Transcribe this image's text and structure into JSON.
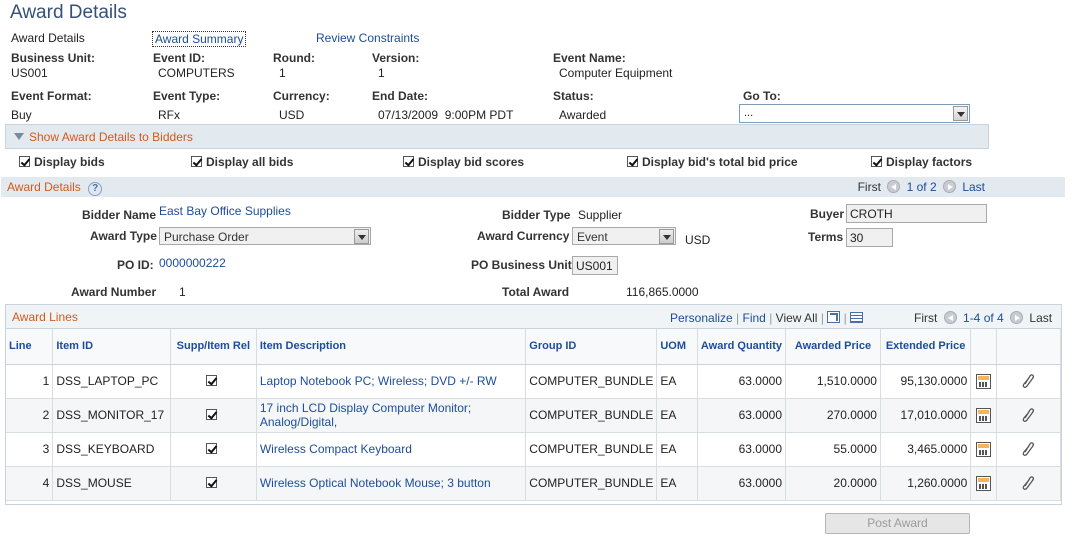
{
  "page": {
    "title": "Award Details"
  },
  "tabs": [
    {
      "label": "Award Details"
    },
    {
      "label": "Award Summary"
    },
    {
      "label": "Review Constraints"
    }
  ],
  "event": {
    "business_unit": {
      "label": "Business Unit:",
      "value": "US001"
    },
    "event_id": {
      "label": "Event ID:",
      "value": "COMPUTERS"
    },
    "round": {
      "label": "Round:",
      "value": "1"
    },
    "version": {
      "label": "Version:",
      "value": "1"
    },
    "event_name": {
      "label": "Event Name:",
      "value": "Computer Equipment"
    },
    "event_format": {
      "label": "Event Format:",
      "value": "Buy"
    },
    "event_type": {
      "label": "Event Type:",
      "value": "RFx"
    },
    "currency": {
      "label": "Currency:",
      "value": "USD"
    },
    "end_date": {
      "label": "End Date:",
      "value": "07/13/2009  9:00PM PDT"
    },
    "status": {
      "label": "Status:",
      "value": "Awarded"
    },
    "goto": {
      "label": "Go To:",
      "value": "..."
    }
  },
  "show_bar": {
    "label": "Show Award Details to Bidders"
  },
  "checkboxes": [
    {
      "label": "Display bids",
      "checked": true
    },
    {
      "label": "Display all bids",
      "checked": true
    },
    {
      "label": "Display bid scores",
      "checked": true
    },
    {
      "label": "Display bid's total bid price",
      "checked": true
    },
    {
      "label": "Display factors",
      "checked": true
    }
  ],
  "award_section": {
    "title": "Award Details",
    "help": "?",
    "nav": {
      "first": "First",
      "range": "1 of 2",
      "last": "Last"
    }
  },
  "award": {
    "bidder_name": {
      "label": "Bidder Name",
      "value": "East Bay Office Supplies"
    },
    "bidder_type": {
      "label": "Bidder Type",
      "value": "Supplier"
    },
    "buyer": {
      "label": "Buyer",
      "value": "CROTH"
    },
    "award_type": {
      "label": "Award Type",
      "value": "Purchase Order"
    },
    "award_currency": {
      "label": "Award Currency",
      "value": "Event",
      "code": "USD"
    },
    "terms": {
      "label": "Terms",
      "value": "30"
    },
    "po_id": {
      "label": "PO ID:",
      "value": "0000000222"
    },
    "po_business_unit": {
      "label": "PO Business Unit",
      "value": "US001"
    },
    "award_number": {
      "label": "Award Number",
      "value": "1"
    },
    "total_award": {
      "label": "Total Award",
      "value": "116,865.0000"
    }
  },
  "lines": {
    "title": "Award Lines",
    "toolbar": {
      "personalize": "Personalize",
      "find": "Find",
      "view_all": "View All",
      "first": "First",
      "range": "1-4 of 4",
      "last": "Last"
    },
    "columns": [
      "Line",
      "Item ID",
      "Supp/Item Rel",
      "Item Description",
      "Group ID",
      "UOM",
      "Award Quantity",
      "Awarded Price",
      "Extended Price"
    ],
    "rows": [
      {
        "line": "1",
        "item_id": "DSS_LAPTOP_PC",
        "desc": "Laptop Notebook PC; Wireless; DVD +/- RW",
        "desc2": "",
        "group": "COMPUTER_BUNDLE",
        "uom": "EA",
        "qty": "63.0000",
        "price": "1,510.0000",
        "ext": "95,130.0000"
      },
      {
        "line": "2",
        "item_id": "DSS_MONITOR_17",
        "desc": "17 inch LCD Display Computer Monitor;",
        "desc2": "Analog/Digital,",
        "group": "COMPUTER_BUNDLE",
        "uom": "EA",
        "qty": "63.0000",
        "price": "270.0000",
        "ext": "17,010.0000"
      },
      {
        "line": "3",
        "item_id": "DSS_KEYBOARD",
        "desc": "Wireless Compact Keyboard",
        "desc2": "",
        "group": "COMPUTER_BUNDLE",
        "uom": "EA",
        "qty": "63.0000",
        "price": "55.0000",
        "ext": "3,465.0000"
      },
      {
        "line": "4",
        "item_id": "DSS_MOUSE",
        "desc": "Wireless Optical Notebook Mouse; 3 button",
        "desc2": "",
        "group": "COMPUTER_BUNDLE",
        "uom": "EA",
        "qty": "63.0000",
        "price": "20.0000",
        "ext": "1,260.0000"
      }
    ]
  },
  "post_award": {
    "label": "Post Award"
  },
  "icons": {
    "calculator": "calculator-icon",
    "attachment": "paperclip-icon",
    "help": "help-icon",
    "zoom": "zoom-icon",
    "download": "grid-download-icon"
  },
  "colors": {
    "section_header": "#d35b1a",
    "link": "#1c4d9c",
    "title": "#35507a",
    "band": "#e2e9ef"
  }
}
